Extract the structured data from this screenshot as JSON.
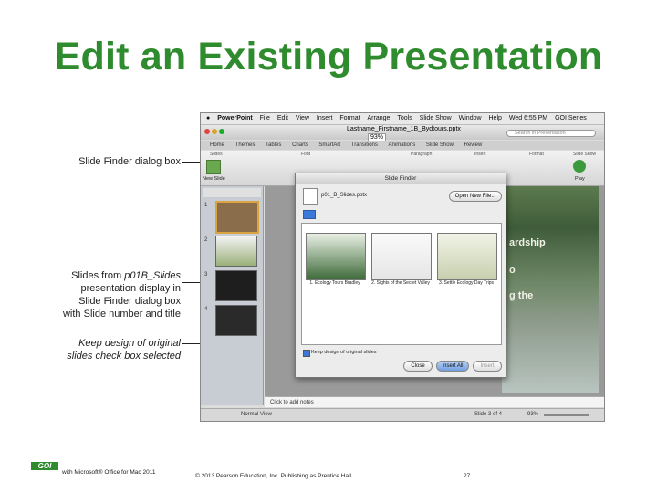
{
  "slide_title": "Edit an Existing Presentation",
  "callouts": {
    "slide_finder": "Slide Finder dialog box",
    "slides_from": [
      "Slides from",
      "p01B_Slides",
      "presentation display in",
      "Slide Finder dialog box",
      "with Slide number and title"
    ],
    "keep_design": [
      "Keep design of original",
      "slides check box selected"
    ]
  },
  "app": {
    "menubar": [
      "PowerPoint",
      "File",
      "Edit",
      "View",
      "Insert",
      "Format",
      "Arrange",
      "Tools",
      "Slide Show",
      "Window",
      "Help"
    ],
    "clock": "Wed 6:55 PM",
    "user": "GOI Series",
    "window_title": "Lastname_Firstname_1B_Bydtours.pptx",
    "zoom": "93%",
    "search_placeholder": "Search in Presentation",
    "ribbon_tabs": [
      "Home",
      "Themes",
      "Tables",
      "Charts",
      "SmartArt",
      "Transitions",
      "Animations",
      "Slide Show",
      "Review"
    ],
    "ribbon_groups": [
      "Slides",
      "Font",
      "Paragraph",
      "Insert",
      "Format",
      "Slide Show"
    ],
    "new_slide": "New Slide",
    "play": "Play",
    "slide_nums": [
      "1",
      "2",
      "3",
      "4"
    ],
    "slide_text": [
      "ardship",
      "o",
      "g the"
    ],
    "notes": "Click to add notes",
    "status_view": "Normal View",
    "status_slide": "Slide 3 of 4",
    "status_zoom": "93%"
  },
  "dialog": {
    "title": "Slide Finder",
    "filename": "p01_B_Slides.pptx",
    "open_button": "Open New File...",
    "slides": [
      {
        "caption": "1. Ecology Tours Bradley"
      },
      {
        "caption": "2. Sights of the Secret Valley"
      },
      {
        "caption": "3. Settle Ecology Day Trips"
      }
    ],
    "keep_design_label": "Keep design of original slides",
    "buttons": {
      "close": "Close",
      "insert_all": "Insert All",
      "insert": "Insert"
    }
  },
  "footer": {
    "logo": "GOI",
    "left": "with Microsoft® Office for Mac 2011",
    "center": "© 2013 Pearson Education, Inc. Publishing as Prentice Hall",
    "page": "27"
  }
}
